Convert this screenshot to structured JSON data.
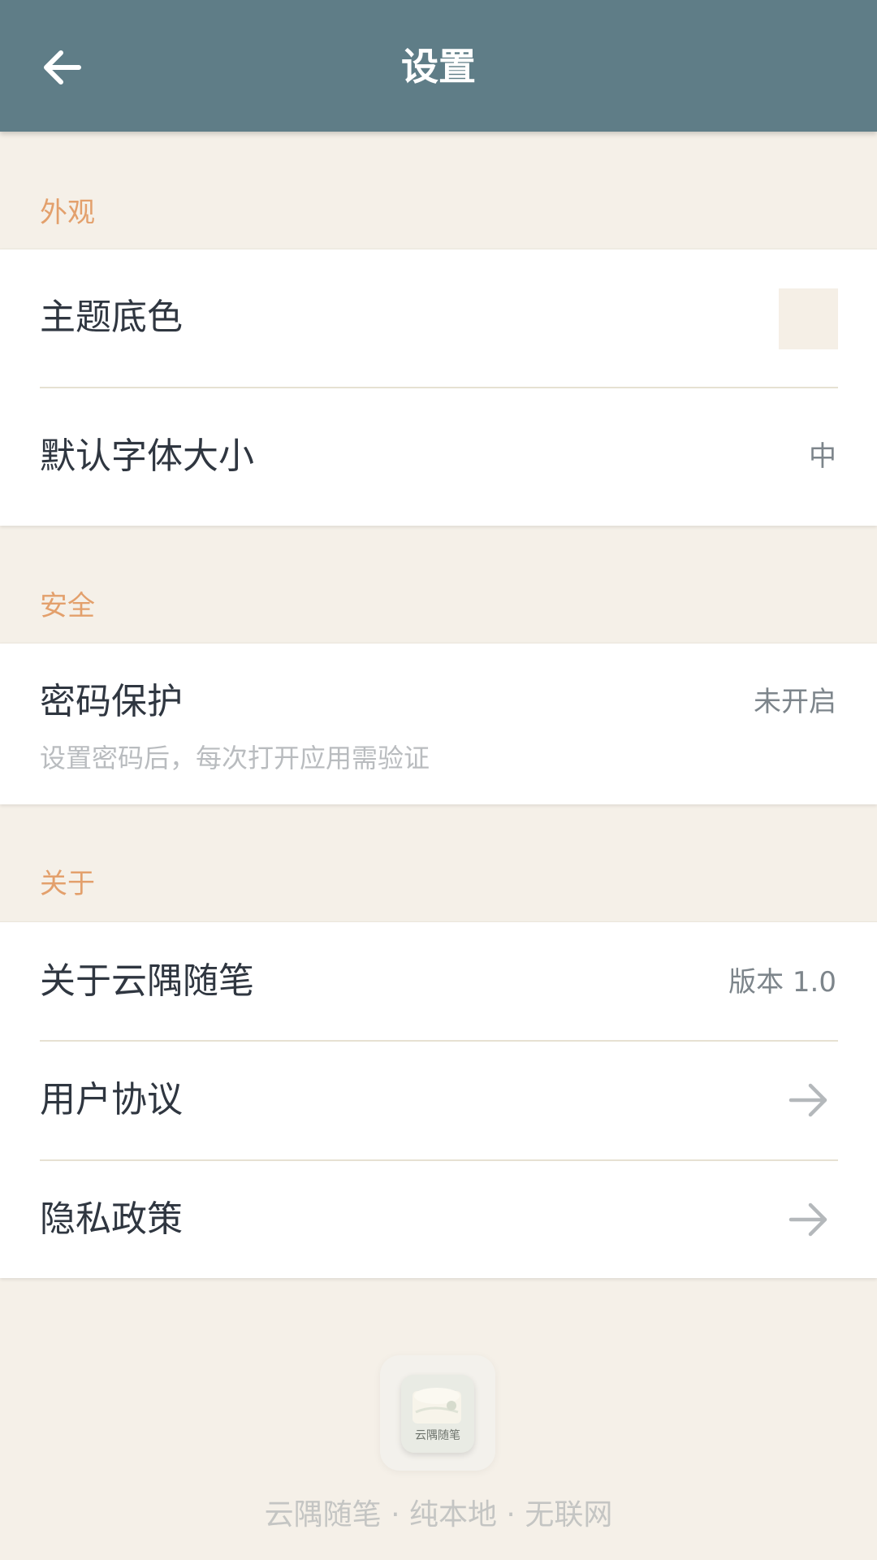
{
  "header": {
    "title": "设置",
    "back_icon": "arrow-left-icon"
  },
  "sections": {
    "appearance": {
      "title": "外观",
      "theme_color": {
        "label": "主题底色",
        "swatch_color": "#f5efe6"
      },
      "font_size": {
        "label": "默认字体大小",
        "value": "中"
      }
    },
    "security": {
      "title": "安全",
      "password": {
        "label": "密码保护",
        "value": "未开启",
        "description": "设置密码后，每次打开应用需验证"
      }
    },
    "about": {
      "title": "关于",
      "about_app": {
        "label": "关于云隅随笔",
        "value": "版本 1.0"
      },
      "user_agreement": {
        "label": "用户协议",
        "icon": "arrow-right-icon"
      },
      "privacy_policy": {
        "label": "隐私政策",
        "icon": "arrow-right-icon"
      }
    }
  },
  "footer": {
    "logo_text": "云隅随笔",
    "tagline": "云隅随笔 · 纯本地 · 无联网"
  },
  "colors": {
    "topbar": "#5f7d87",
    "background": "#f5f0e8",
    "section_header": "#e3a06c"
  }
}
